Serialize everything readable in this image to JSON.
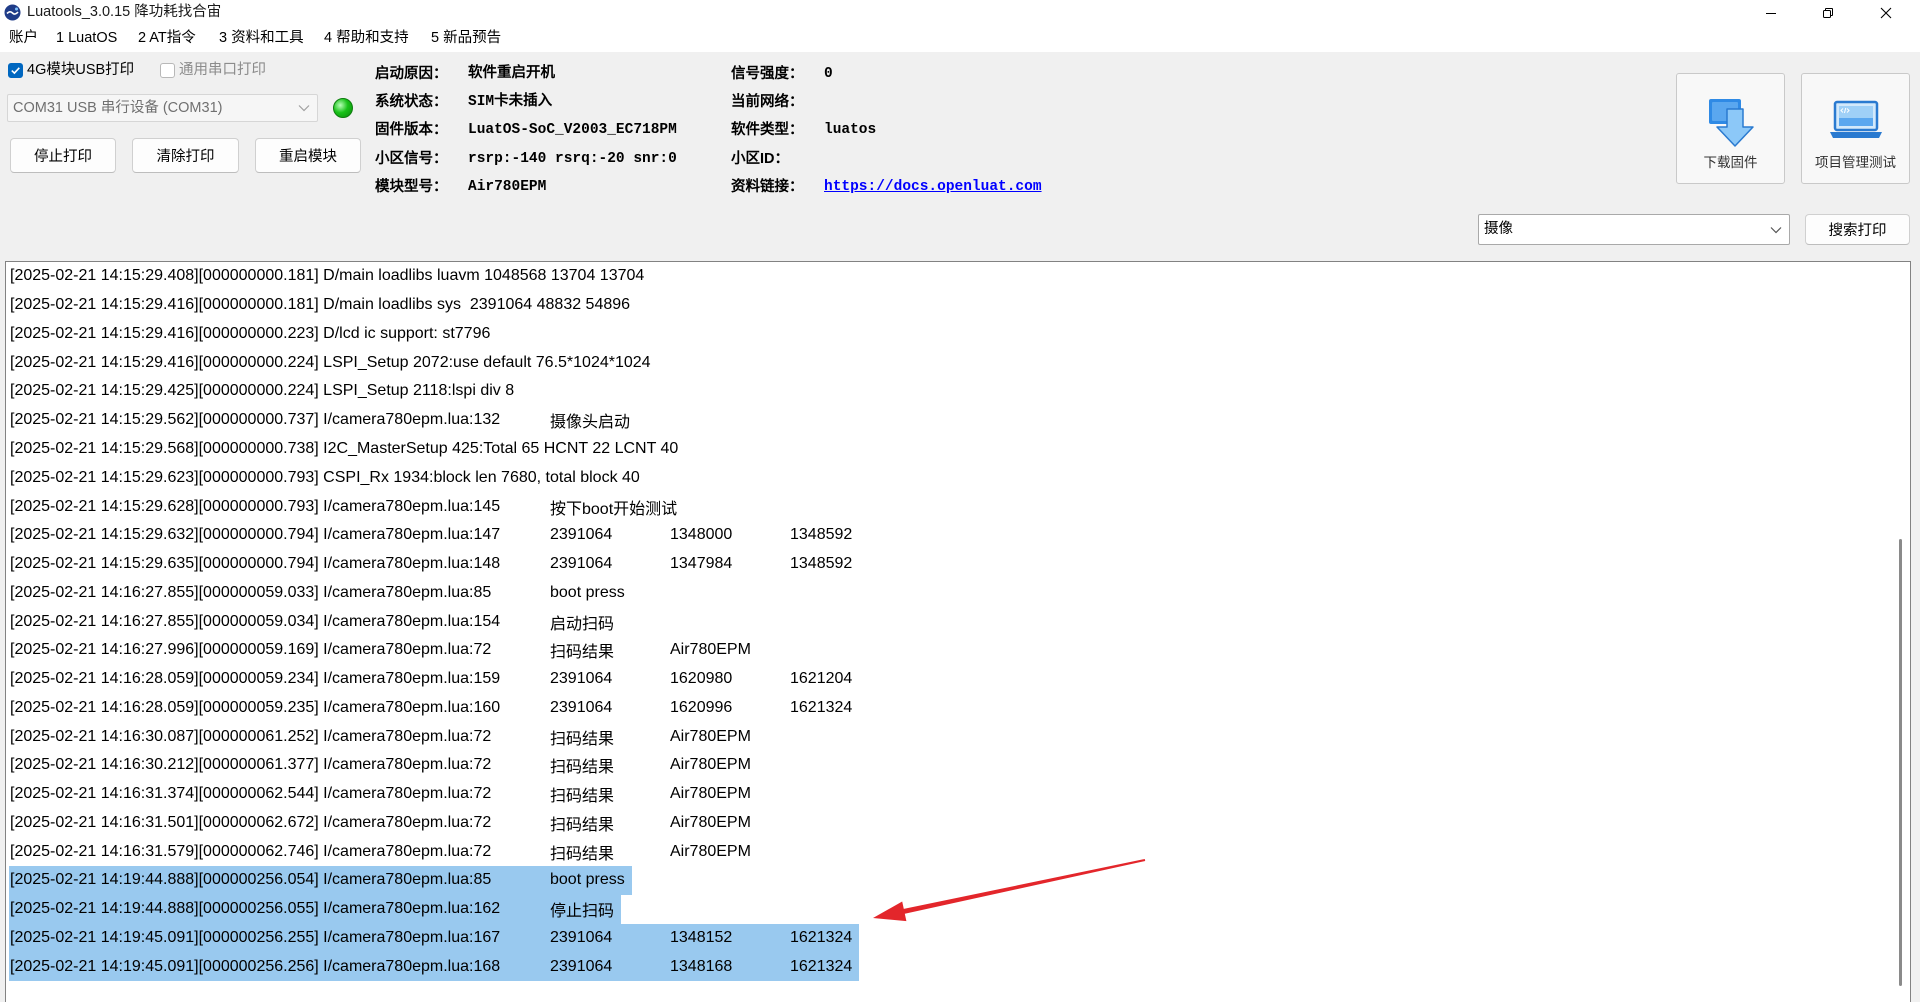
{
  "window": {
    "title": "Luatools_3.0.15 降功耗找合宙"
  },
  "menu": [
    "账户",
    "1 LuatOS",
    "2 AT指令",
    "3 资料和工具",
    "4 帮助和支持",
    "5 新品预告"
  ],
  "print_options": {
    "usb_print": {
      "label": "4G模块USB打印",
      "checked": true
    },
    "serial_print": {
      "label": "通用串口打印",
      "checked": false
    }
  },
  "port": {
    "selected": "COM31 USB 串行设备 (COM31)"
  },
  "actions": {
    "stop_print": "停止打印",
    "clear_print": "清除打印",
    "restart_module": "重启模块",
    "download_firmware": "下载固件",
    "project_test": "项目管理测试"
  },
  "device_info": {
    "left": [
      {
        "label": "启动原因：",
        "value": "软件重启开机"
      },
      {
        "label": "系统状态：",
        "value": "SIM卡未插入"
      },
      {
        "label": "固件版本：",
        "value": "LuatOS-SoC_V2003_EC718PM"
      },
      {
        "label": "小区信号：",
        "value": "rsrp:-140 rsrq:-20 snr:0"
      },
      {
        "label": "模块型号：",
        "value": "Air780EPM"
      }
    ],
    "right": [
      {
        "label": "信号强度：",
        "value": "0"
      },
      {
        "label": "当前网络：",
        "value": ""
      },
      {
        "label": "软件类型：",
        "value": "luatos"
      },
      {
        "label": "小区ID：",
        "value": ""
      },
      {
        "label": "资料链接：",
        "value": "https://docs.openluat.com"
      }
    ]
  },
  "search": {
    "value": "摄像",
    "button": "搜索打印"
  },
  "log": {
    "lines": [
      {
        "text": "[2025-02-21 14:15:29.408][000000000.181] D/main loadlibs luavm 1048568 13704 13704"
      },
      {
        "text": "[2025-02-21 14:15:29.416][000000000.181] D/main loadlibs sys  2391064 48832 54896"
      },
      {
        "text": "[2025-02-21 14:15:29.416][000000000.223] D/lcd ic support: st7796"
      },
      {
        "text": "[2025-02-21 14:15:29.416][000000000.224] LSPI_Setup 2072:use default 76.5*1024*1024"
      },
      {
        "text": "[2025-02-21 14:15:29.425][000000000.224] LSPI_Setup 2118:lspi div 8"
      },
      {
        "text": "[2025-02-21 14:15:29.562][000000000.737] I/camera780epm.lua:132",
        "fields": [
          "摄像头启动"
        ]
      },
      {
        "text": "[2025-02-21 14:15:29.568][000000000.738] I2C_MasterSetup 425:Total 65 HCNT 22 LCNT 40"
      },
      {
        "text": "[2025-02-21 14:15:29.623][000000000.793] CSPI_Rx 1934:block len 7680, total block 40"
      },
      {
        "text": "[2025-02-21 14:15:29.628][000000000.793] I/camera780epm.lua:145",
        "fields": [
          "按下boot开始测试"
        ]
      },
      {
        "text": "[2025-02-21 14:15:29.632][000000000.794] I/camera780epm.lua:147",
        "fields": [
          "2391064",
          "1348000",
          "1348592"
        ]
      },
      {
        "text": "[2025-02-21 14:15:29.635][000000000.794] I/camera780epm.lua:148",
        "fields": [
          "2391064",
          "1347984",
          "1348592"
        ]
      },
      {
        "text": "[2025-02-21 14:16:27.855][000000059.033] I/camera780epm.lua:85",
        "fields": [
          "boot press"
        ]
      },
      {
        "text": "[2025-02-21 14:16:27.855][000000059.034] I/camera780epm.lua:154",
        "fields": [
          "启动扫码"
        ]
      },
      {
        "text": "[2025-02-21 14:16:27.996][000000059.169] I/camera780epm.lua:72",
        "fields": [
          "扫码结果",
          "Air780EPM"
        ]
      },
      {
        "text": "[2025-02-21 14:16:28.059][000000059.234] I/camera780epm.lua:159",
        "fields": [
          "2391064",
          "1620980",
          "1621204"
        ]
      },
      {
        "text": "[2025-02-21 14:16:28.059][000000059.235] I/camera780epm.lua:160",
        "fields": [
          "2391064",
          "1620996",
          "1621324"
        ]
      },
      {
        "text": "[2025-02-21 14:16:30.087][000000061.252] I/camera780epm.lua:72",
        "fields": [
          "扫码结果",
          "Air780EPM"
        ]
      },
      {
        "text": "[2025-02-21 14:16:30.212][000000061.377] I/camera780epm.lua:72",
        "fields": [
          "扫码结果",
          "Air780EPM"
        ]
      },
      {
        "text": "[2025-02-21 14:16:31.374][000000062.544] I/camera780epm.lua:72",
        "fields": [
          "扫码结果",
          "Air780EPM"
        ]
      },
      {
        "text": "[2025-02-21 14:16:31.501][000000062.672] I/camera780epm.lua:72",
        "fields": [
          "扫码结果",
          "Air780EPM"
        ]
      },
      {
        "text": "[2025-02-21 14:16:31.579][000000062.746] I/camera780epm.lua:72",
        "fields": [
          "扫码结果",
          "Air780EPM"
        ]
      },
      {
        "text": "[2025-02-21 14:19:44.888][000000256.054] I/camera780epm.lua:85",
        "fields": [
          "boot press"
        ],
        "selected": true
      },
      {
        "text": "[2025-02-21 14:19:44.888][000000256.055] I/camera780epm.lua:162",
        "fields": [
          "停止扫码"
        ],
        "selected": true
      },
      {
        "text": "[2025-02-21 14:19:45.091][000000256.255] I/camera780epm.lua:167",
        "fields": [
          "2391064",
          "1348152",
          "1621324"
        ],
        "selected": true
      },
      {
        "text": "[2025-02-21 14:19:45.091][000000256.256] I/camera780epm.lua:168",
        "fields": [
          "2391064",
          "1348168",
          "1621324"
        ],
        "selected": true
      }
    ]
  },
  "colors": {
    "selection": "#99c9ef",
    "checkbox_accent": "#0067c0",
    "link": "#0000ff",
    "status_led": "#19c219",
    "annotation_arrow": "#e3262b"
  },
  "icons": {
    "app": "luatools-logo-icon",
    "minimize": "minimize-icon",
    "restore": "restore-icon",
    "close": "close-icon",
    "download_firmware": "download-arrow-icon",
    "project_test": "laptop-code-icon",
    "dropdown": "chevron-down-icon",
    "annotation": "red-arrow-icon"
  }
}
